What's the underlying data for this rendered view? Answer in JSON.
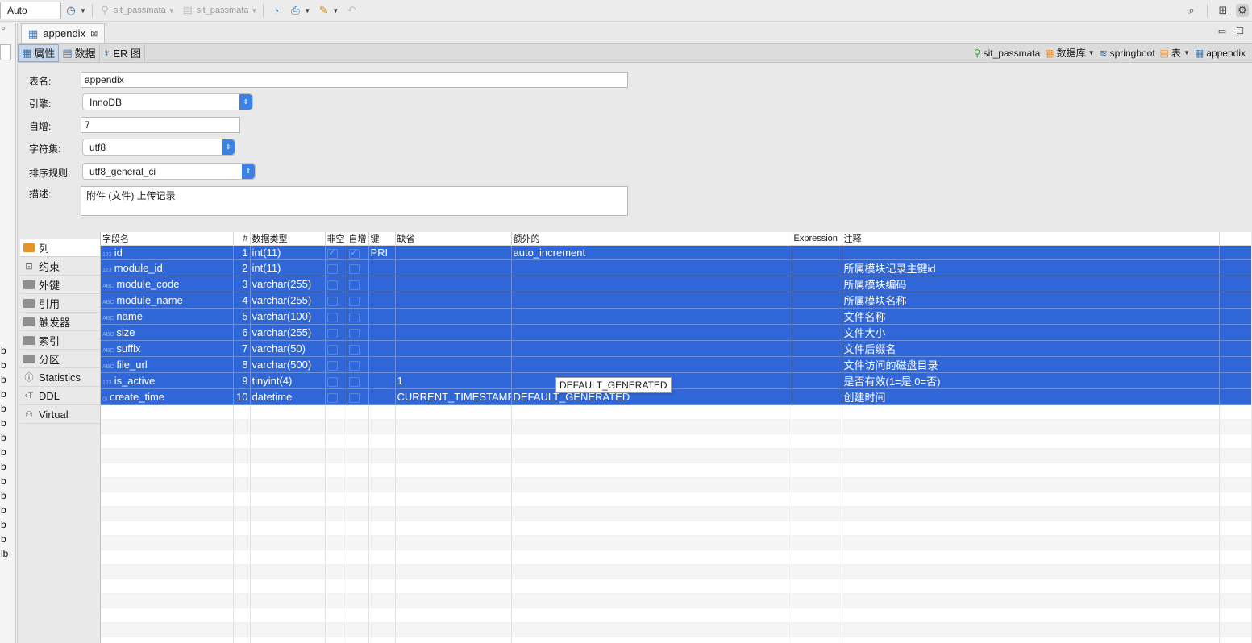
{
  "toolbar": {
    "mode_select": "Auto",
    "connection1": "sit_passmata",
    "connection2": "sit_passmata"
  },
  "left_strip": {
    "letters": [
      "b",
      "b",
      "b",
      "b",
      "b",
      "b",
      "b",
      "b",
      "b",
      "b",
      "b",
      "b",
      "b",
      "b",
      "lb"
    ]
  },
  "editor_tab": {
    "label": "appendix",
    "close": "⊠"
  },
  "subtabs": [
    {
      "label": "属性",
      "active": true
    },
    {
      "label": "数据",
      "active": false
    },
    {
      "label": "ER 图",
      "active": false
    }
  ],
  "breadcrumb": {
    "connection": "sit_passmata",
    "database_label": "数据库",
    "database": "springboot",
    "table_label": "表",
    "table": "appendix"
  },
  "properties": {
    "table_name_label": "表名:",
    "table_name": "appendix",
    "engine_label": "引擎:",
    "engine": "InnoDB",
    "auto_inc_label": "自增:",
    "auto_inc": "7",
    "charset_label": "字符集:",
    "charset": "utf8",
    "collation_label": "排序规则:",
    "collation": "utf8_general_ci",
    "desc_label": "描述:",
    "desc": "附件 (文件) 上传记录"
  },
  "side_nav": [
    {
      "label": "列",
      "icon": "columns-icon",
      "active": true
    },
    {
      "label": "约束",
      "icon": "constraint-icon",
      "active": false
    },
    {
      "label": "外键",
      "icon": "folder-icon",
      "active": false
    },
    {
      "label": "引用",
      "icon": "folder-icon",
      "active": false
    },
    {
      "label": "触发器",
      "icon": "folder-icon",
      "active": false
    },
    {
      "label": "索引",
      "icon": "folder-icon",
      "active": false
    },
    {
      "label": "分区",
      "icon": "folder-icon",
      "active": false
    },
    {
      "label": "Statistics",
      "icon": "info-icon",
      "active": false
    },
    {
      "label": "DDL",
      "icon": "ddl-icon",
      "active": false
    },
    {
      "label": "Virtual",
      "icon": "virtual-icon",
      "active": false
    }
  ],
  "columns_header": [
    "字段名",
    "#",
    "数据类型",
    "非空",
    "自增",
    "键",
    "缺省",
    "额外的",
    "Expression",
    "注释"
  ],
  "columns": [
    {
      "icon": "123",
      "name": "id",
      "num": "1",
      "type": "int(11)",
      "notnull": true,
      "autoinc": true,
      "key": "PRI",
      "default": "",
      "extra": "auto_increment",
      "expr": "",
      "comment": ""
    },
    {
      "icon": "123",
      "name": "module_id",
      "num": "2",
      "type": "int(11)",
      "notnull": false,
      "autoinc": false,
      "key": "",
      "default": "",
      "extra": "",
      "expr": "",
      "comment": "所属模块记录主键id"
    },
    {
      "icon": "ABC",
      "name": "module_code",
      "num": "3",
      "type": "varchar(255)",
      "notnull": false,
      "autoinc": false,
      "key": "",
      "default": "",
      "extra": "",
      "expr": "",
      "comment": "所属模块编码"
    },
    {
      "icon": "ABC",
      "name": "module_name",
      "num": "4",
      "type": "varchar(255)",
      "notnull": false,
      "autoinc": false,
      "key": "",
      "default": "",
      "extra": "",
      "expr": "",
      "comment": "所属模块名称"
    },
    {
      "icon": "ABC",
      "name": "name",
      "num": "5",
      "type": "varchar(100)",
      "notnull": false,
      "autoinc": false,
      "key": "",
      "default": "",
      "extra": "",
      "expr": "",
      "comment": "文件名称"
    },
    {
      "icon": "ABC",
      "name": "size",
      "num": "6",
      "type": "varchar(255)",
      "notnull": false,
      "autoinc": false,
      "key": "",
      "default": "",
      "extra": "",
      "expr": "",
      "comment": "文件大小"
    },
    {
      "icon": "ABC",
      "name": "suffix",
      "num": "7",
      "type": "varchar(50)",
      "notnull": false,
      "autoinc": false,
      "key": "",
      "default": "",
      "extra": "",
      "expr": "",
      "comment": "文件后缀名"
    },
    {
      "icon": "ABC",
      "name": "file_url",
      "num": "8",
      "type": "varchar(500)",
      "notnull": false,
      "autoinc": false,
      "key": "",
      "default": "",
      "extra": "",
      "expr": "",
      "comment": "文件访问的磁盘目录"
    },
    {
      "icon": "123",
      "name": "is_active",
      "num": "9",
      "type": "tinyint(4)",
      "notnull": false,
      "autoinc": false,
      "key": "",
      "default": "1",
      "extra": "",
      "expr": "",
      "comment": "是否有效(1=是;0=否)"
    },
    {
      "icon": "◷",
      "name": "create_time",
      "num": "10",
      "type": "datetime",
      "notnull": false,
      "autoinc": false,
      "key": "",
      "default": "CURRENT_TIMESTAMP",
      "extra": "DEFAULT_GENERATED",
      "expr": "",
      "comment": "创建时间"
    }
  ],
  "tooltip": "DEFAULT_GENERATED",
  "colors": {
    "selection": "#2f67d8",
    "accent": "#3a82e6"
  }
}
